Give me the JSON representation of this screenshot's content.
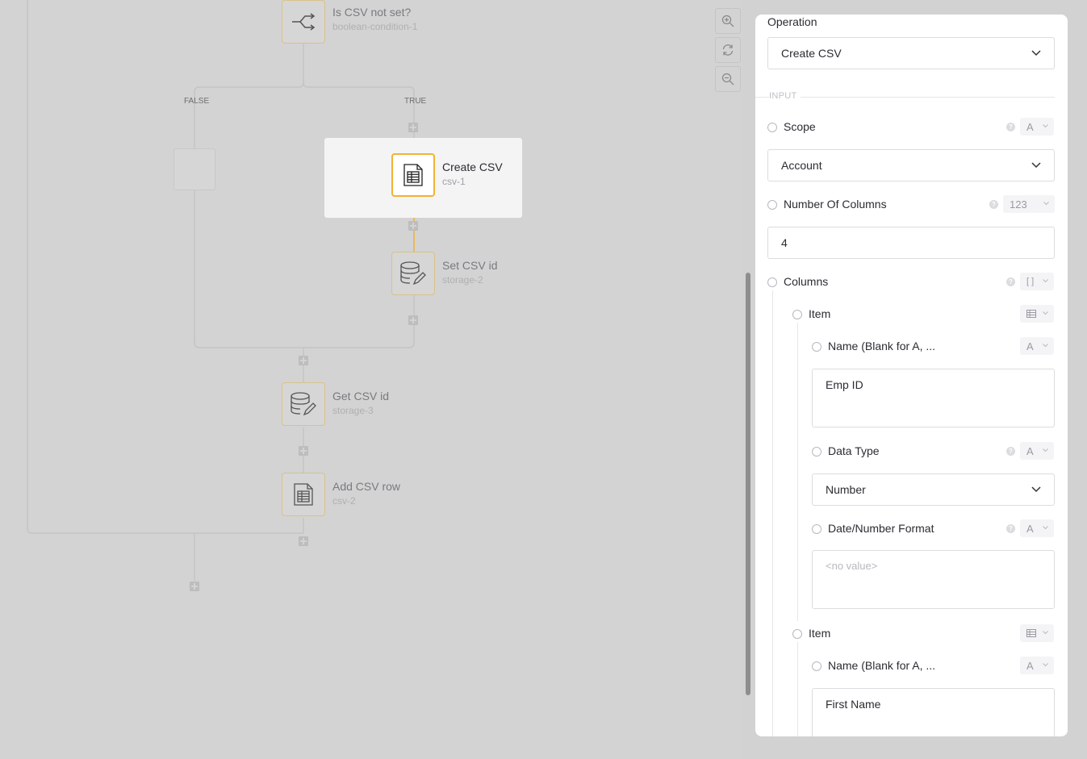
{
  "flow": {
    "condition": {
      "title": "Is CSV not set?",
      "id": "boolean-condition-1"
    },
    "branch_false": "FALSE",
    "branch_true": "TRUE",
    "create_csv": {
      "title": "Create CSV",
      "id": "csv-1"
    },
    "set_csv": {
      "title": "Set CSV id",
      "id": "storage-2"
    },
    "get_csv": {
      "title": "Get CSV id",
      "id": "storage-3"
    },
    "add_row": {
      "title": "Add CSV row",
      "id": "csv-2"
    }
  },
  "zoom": {
    "in_icon": "zoom-in-icon",
    "reset_icon": "refresh-icon",
    "out_icon": "zoom-out-icon"
  },
  "panel": {
    "operation_label": "Operation",
    "operation_value": "Create CSV",
    "input_section": "INPUT",
    "scope": {
      "label": "Scope",
      "type": "A",
      "value": "Account"
    },
    "num_columns": {
      "label": "Number Of Columns",
      "type": "123",
      "value": "4"
    },
    "columns": {
      "label": "Columns",
      "type": "[ ]"
    },
    "items": [
      {
        "label": "Item",
        "name_label": "Name (Blank for A, ...",
        "name_type": "A",
        "name_value": "Emp ID",
        "data_type_label": "Data Type",
        "data_type_type": "A",
        "data_type_value": "Number",
        "format_label": "Date/Number Format",
        "format_type": "A",
        "format_placeholder": "<no value>"
      },
      {
        "label": "Item",
        "name_label": "Name (Blank for A, ...",
        "name_type": "A",
        "name_value": "First Name"
      }
    ]
  }
}
